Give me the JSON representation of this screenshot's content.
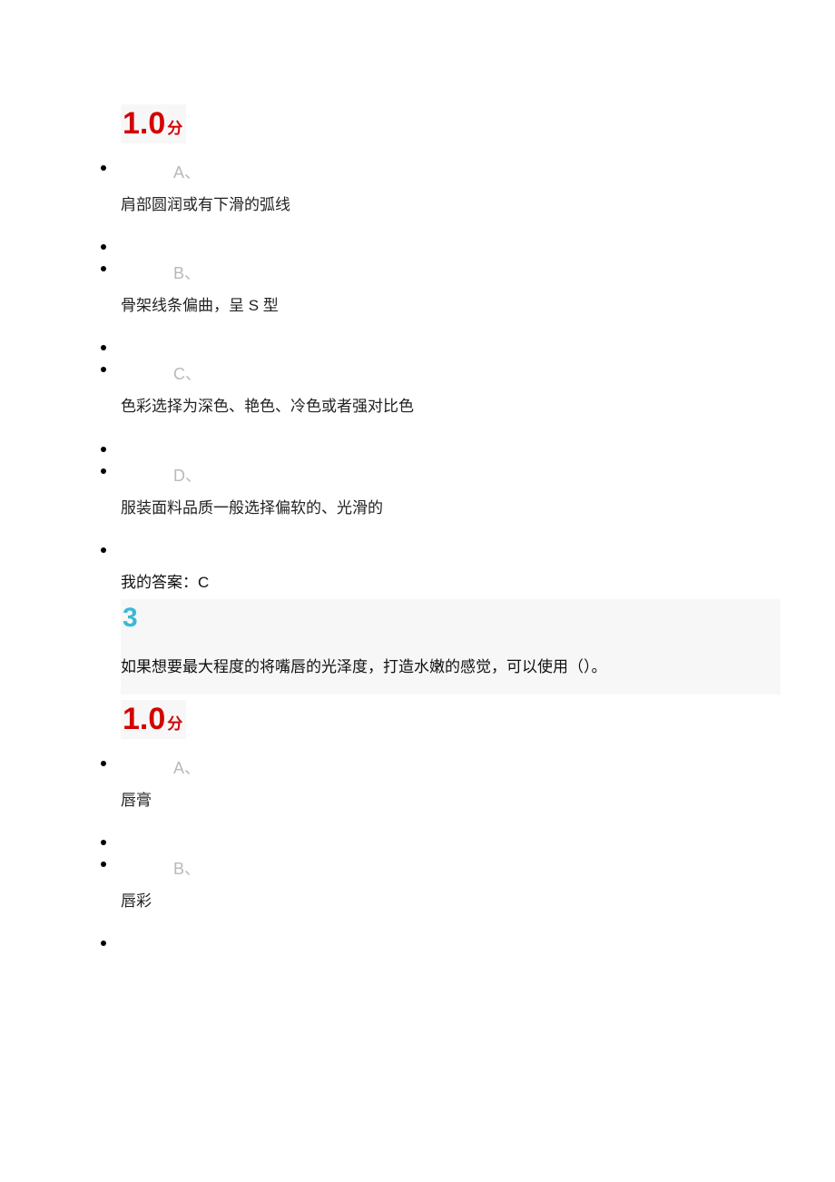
{
  "q2": {
    "score": "1.0",
    "score_unit": "分",
    "options": [
      {
        "letter": "A、",
        "text": "肩部圆润或有下滑的弧线"
      },
      {
        "letter": "B、",
        "text": "骨架线条偏曲，呈 S 型"
      },
      {
        "letter": "C、",
        "text": "色彩选择为深色、艳色、冷色或者强对比色"
      },
      {
        "letter": "D、",
        "text": "服装面料品质一般选择偏软的、光滑的"
      }
    ],
    "answer_label": "我的答案：",
    "answer_value": "C"
  },
  "q3": {
    "number": "3",
    "question": "如果想要最大程度的将嘴唇的光泽度，打造水嫩的感觉，可以使用（）。",
    "score": "1.0",
    "score_unit": "分",
    "options": [
      {
        "letter": "A、",
        "text": "唇膏"
      },
      {
        "letter": "B、",
        "text": "唇彩"
      }
    ]
  }
}
